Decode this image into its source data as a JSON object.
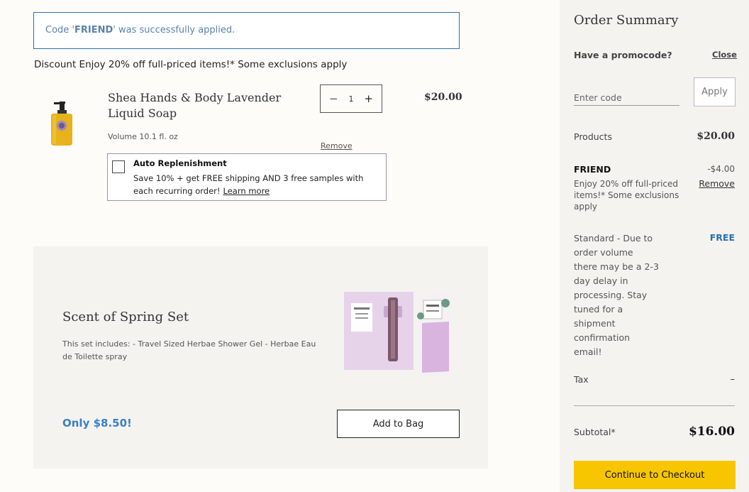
{
  "notice": {
    "prefix": "Code '",
    "code": "FRIEND",
    "suffix": "' was successfully applied."
  },
  "discount_line": "Discount Enjoy 20% off full-priced items!* Some exclusions apply",
  "cart_item": {
    "name": "Shea Hands & Body Lavender Liquid Soap",
    "volume": "Volume 10.1 fl. oz",
    "quantity": "1",
    "price": "$20.00",
    "remove_label": "Remove"
  },
  "auto_replenishment": {
    "title": "Auto Replenishment",
    "description": "Save 10% + get FREE shipping AND 3 free samples with each recurring order!",
    "learn_more": "Learn more"
  },
  "promo": {
    "title": "Scent of Spring Set",
    "description": "This set includes: - Travel Sized Herbae Shower Gel - Herbae Eau de Toilette spray",
    "price": "Only $8.50!",
    "button": "Add to Bag"
  },
  "summary": {
    "title": "Order Summary",
    "promocode_question": "Have a promocode?",
    "close": "Close",
    "code_placeholder": "Enter code",
    "apply": "Apply",
    "products_label": "Products",
    "products_value": "$20.00",
    "friend_label": "FRIEND",
    "friend_desc": "Enjoy 20% off full-priced items!* Some exclusions apply",
    "friend_amount": "-$4.00",
    "friend_remove": "Remove",
    "shipping_desc": "Standard - Due to order volume there may be a 2-3 day delay in processing. Stay tuned for a shipment confirmation email!",
    "shipping_value": "FREE",
    "tax_label": "Tax",
    "tax_value": "–",
    "subtotal_label": "Subtotal*",
    "subtotal_value": "$16.00",
    "checkout": "Continue to Checkout"
  },
  "colors": {
    "accent_blue": "#3b7fc4",
    "checkout_yellow": "#f7c600",
    "notice_border": "#2f6fa8"
  },
  "icons": {
    "minus": "minus-icon",
    "plus": "plus-icon",
    "checkbox": "checkbox-icon"
  }
}
